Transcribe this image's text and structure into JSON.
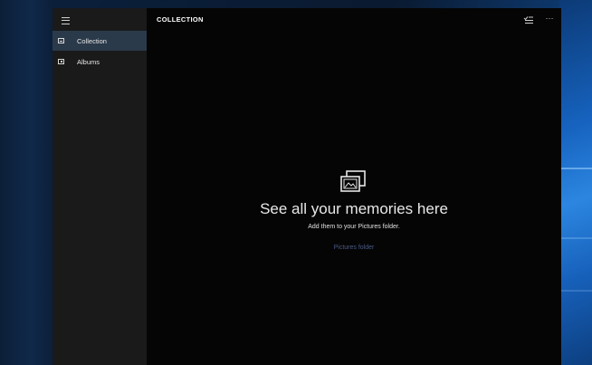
{
  "window": {
    "page_title": "COLLECTION"
  },
  "sidebar": {
    "menu_icon": "hamburger-menu-icon",
    "items": [
      {
        "label": "Collection",
        "icon": "collection-icon",
        "selected": true
      },
      {
        "label": "Albums",
        "icon": "albums-icon",
        "selected": false
      }
    ]
  },
  "toolbar": {
    "select_icon": "select-items-icon",
    "more_label": "···"
  },
  "empty_state": {
    "icon": "photos-icon",
    "title": "See all your memories here",
    "subtitle": "Add them to your Pictures folder.",
    "link_label": "Pictures folder"
  },
  "colors": {
    "accent": "#2b3a4a",
    "link": "#4a5a86",
    "background": "#050505",
    "sidebar": "#1a1a1a"
  }
}
